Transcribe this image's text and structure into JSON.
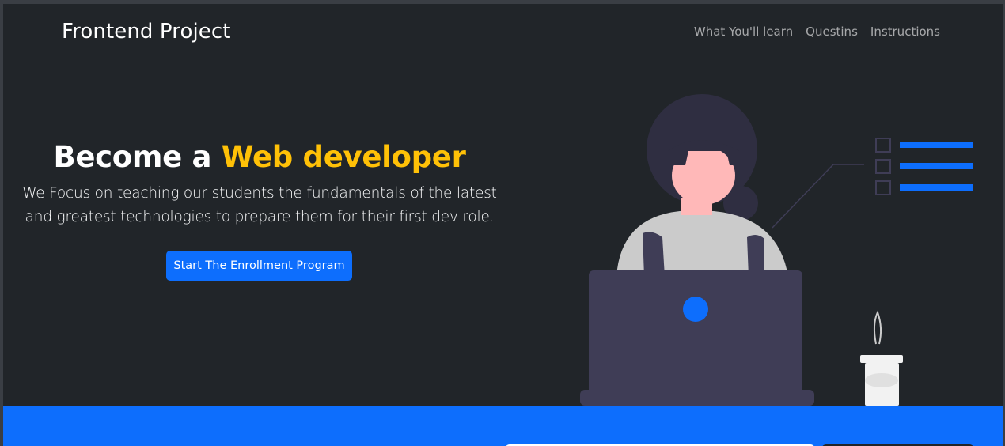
{
  "navbar": {
    "brand": "Frontend Project",
    "links": [
      {
        "label": "What You'll learn"
      },
      {
        "label": "Questins"
      },
      {
        "label": "Instructions"
      }
    ]
  },
  "hero": {
    "title_prefix": "Become a ",
    "title_accent": "Web developer",
    "lead": "We Focus on teaching our students the fundamentals of the latest and greatest technologies to prepare them for their first dev role.",
    "cta_label": "Start The Enrollment Program"
  },
  "colors": {
    "background": "#212529",
    "accent_yellow": "#ffc107",
    "primary_blue": "#0d6efd"
  },
  "icons": {
    "illustration": "woman-at-laptop-illustration"
  }
}
